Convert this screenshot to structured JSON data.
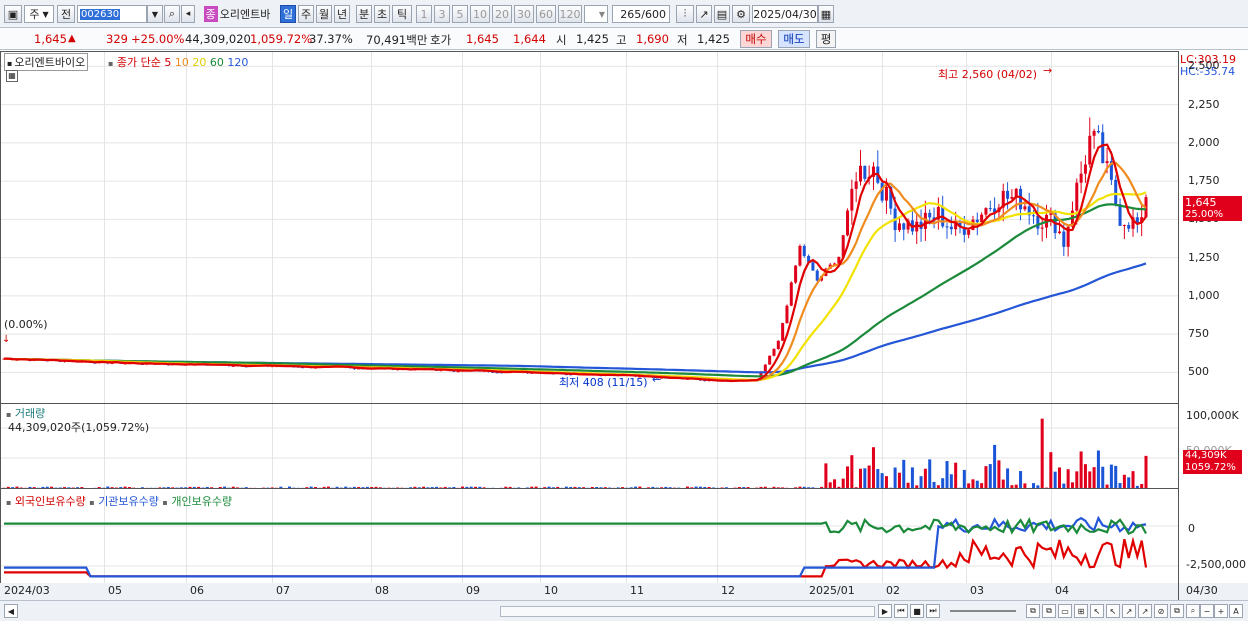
{
  "toolbar": {
    "market": "주",
    "prev": "전",
    "code": "002630",
    "name": "오리엔트바",
    "badge": "종",
    "periods": [
      "일",
      "주",
      "월",
      "년",
      "분",
      "초",
      "틱"
    ],
    "intervals": [
      "1",
      "3",
      "5",
      "10",
      "20",
      "30",
      "60",
      "120"
    ],
    "count": "265",
    "count_max": "/600",
    "date": "2025/04/30"
  },
  "quote": {
    "price": "1,645",
    "change": "329",
    "change_pct": "+25.00%",
    "volume": "44,309,020",
    "volume_pct": "1,059.72%",
    "turnover": "37.37%",
    "amount": "70,491백만",
    "bid_label": "호가",
    "bid": "1,645",
    "ask": "1,644",
    "open_label": "시",
    "open": "1,425",
    "high_label": "고",
    "high": "1,690",
    "low_label": "저",
    "low": "1,425",
    "buy": "매수",
    "sell": "매도",
    "avg": "평"
  },
  "legend": {
    "name": "오리엔트바이오",
    "ma_label": "종가 단순",
    "ma": [
      "5",
      "10",
      "20",
      "60",
      "120"
    ]
  },
  "annotations": {
    "high": "최고 2,560 (04/02)",
    "low": "최저 408 (11/15)",
    "start": "(0.00%)"
  },
  "price_axis": {
    "lc": "LC:303.19",
    "hc": "HC:-35.74",
    "ticks": [
      "2,500",
      "2,250",
      "2,000",
      "1,750",
      "1,500",
      "1,250",
      "1,000",
      "750",
      "500"
    ],
    "last": "1,645",
    "last_pct": "25.00%"
  },
  "volume_panel": {
    "title": "거래량",
    "value": "44,309,020주(1,059.72%)",
    "ticks": [
      "100,000K",
      "50,000K"
    ],
    "last": "44,309K",
    "last_pct": "1059.72%"
  },
  "holdings_panel": {
    "series": [
      "외국인보유수량",
      "기관보유수량",
      "개인보유수량"
    ],
    "ticks": [
      "0",
      "-2,500,000"
    ]
  },
  "dates": [
    "2024/03",
    "05",
    "06",
    "07",
    "08",
    "09",
    "10",
    "11",
    "12",
    "2025/01",
    "02",
    "03",
    "04",
    "04/30"
  ],
  "colors": {
    "up": "#e0001b",
    "down": "#1a55d8",
    "ma5": "#e00000",
    "ma10": "#f08c1e",
    "ma20": "#f2e200",
    "ma60": "#1a8a3a",
    "ma120": "#2456d8"
  }
}
